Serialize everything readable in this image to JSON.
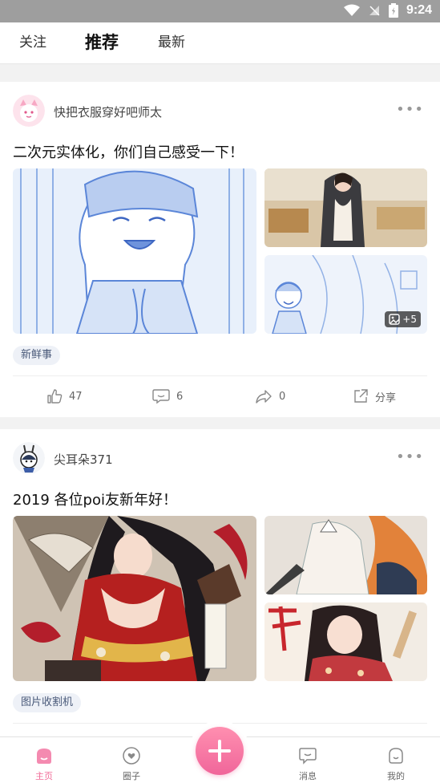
{
  "status_bar": {
    "time": "9:24"
  },
  "tabs": [
    {
      "label": "关注",
      "active": false
    },
    {
      "label": "推荐",
      "active": true
    },
    {
      "label": "最新",
      "active": false
    }
  ],
  "posts": [
    {
      "author": "快把衣服穿好吧师太",
      "title": "二次元实体化，你们自己感受一下！",
      "more_images_count": "+5",
      "tag": "新鲜事",
      "likes": "47",
      "comments": "6",
      "shares": "0",
      "share_label": "分享"
    },
    {
      "author": "尖耳朵371",
      "title": "2019 各位poi友新年好！",
      "tag": "图片收割机"
    }
  ],
  "bottom_nav": [
    {
      "label": "主页",
      "active": true
    },
    {
      "label": "圈子",
      "active": false
    },
    {
      "label": "消息",
      "active": false
    },
    {
      "label": "我的",
      "active": false
    }
  ],
  "colors": {
    "accent": "#f06b97",
    "tag_bg": "#eef1f7",
    "tag_text": "#4a5a7a"
  }
}
